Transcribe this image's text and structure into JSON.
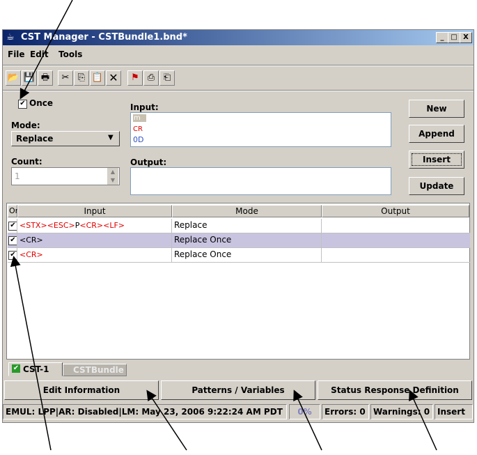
{
  "window": {
    "title": "CST Manager - CSTBundle1.bnd*",
    "controls": [
      "_",
      "□",
      "X"
    ]
  },
  "menu": [
    "File",
    "Edit",
    "Tools"
  ],
  "toolbar": {
    "icons": [
      "open-folder-icon",
      "save-icon",
      "print-icon",
      "cut-icon",
      "copy-icon",
      "paste-icon",
      "delete-icon",
      "import-icon",
      "export-icon",
      "bundle-icon"
    ]
  },
  "form": {
    "once_label": "Once",
    "once_checked": true,
    "mode_label": "Mode:",
    "mode_value": "Replace",
    "count_label": "Count:",
    "count_value": "1",
    "input_label": "Input:",
    "input_lines": [
      "m",
      "CR",
      "0D"
    ],
    "output_label": "Output:",
    "buttons": {
      "new": "New",
      "append": "Append",
      "insert": "Insert",
      "update": "Update"
    }
  },
  "table": {
    "headers": [
      "On",
      "Input",
      "Mode",
      "Output"
    ],
    "rows": [
      {
        "on": true,
        "input_red": "<STX><ESC>",
        "input_black": "P",
        "input_red2": "<CR><LF>",
        "mode": "Replace",
        "output": ""
      },
      {
        "on": true,
        "input_red": "",
        "input_black": "<CR>",
        "input_red2": "",
        "mode": "Replace Once",
        "output": ""
      },
      {
        "on": true,
        "input_red": "<CR>",
        "input_black": "",
        "input_red2": "",
        "mode": "Replace Once",
        "output": ""
      }
    ]
  },
  "tabs": [
    "CST-1",
    "CSTBundle"
  ],
  "bottom_buttons": {
    "edit_info": "Edit Information",
    "patterns": "Patterns / Variables",
    "status_resp": "Status Response Definition"
  },
  "statusbar": {
    "info": "EMUL: LPP|AR: Disabled|LM: May 23, 2006 9:22:24 AM PDT",
    "progress": "0%",
    "errors": "Errors: 0",
    "warnings": "Warnings: 0",
    "mode": "Insert"
  },
  "colors": {
    "title_start": "#0a246a",
    "title_end": "#a6caf0",
    "selected_row": "#c8c4e0",
    "red_text": "#e00000"
  }
}
